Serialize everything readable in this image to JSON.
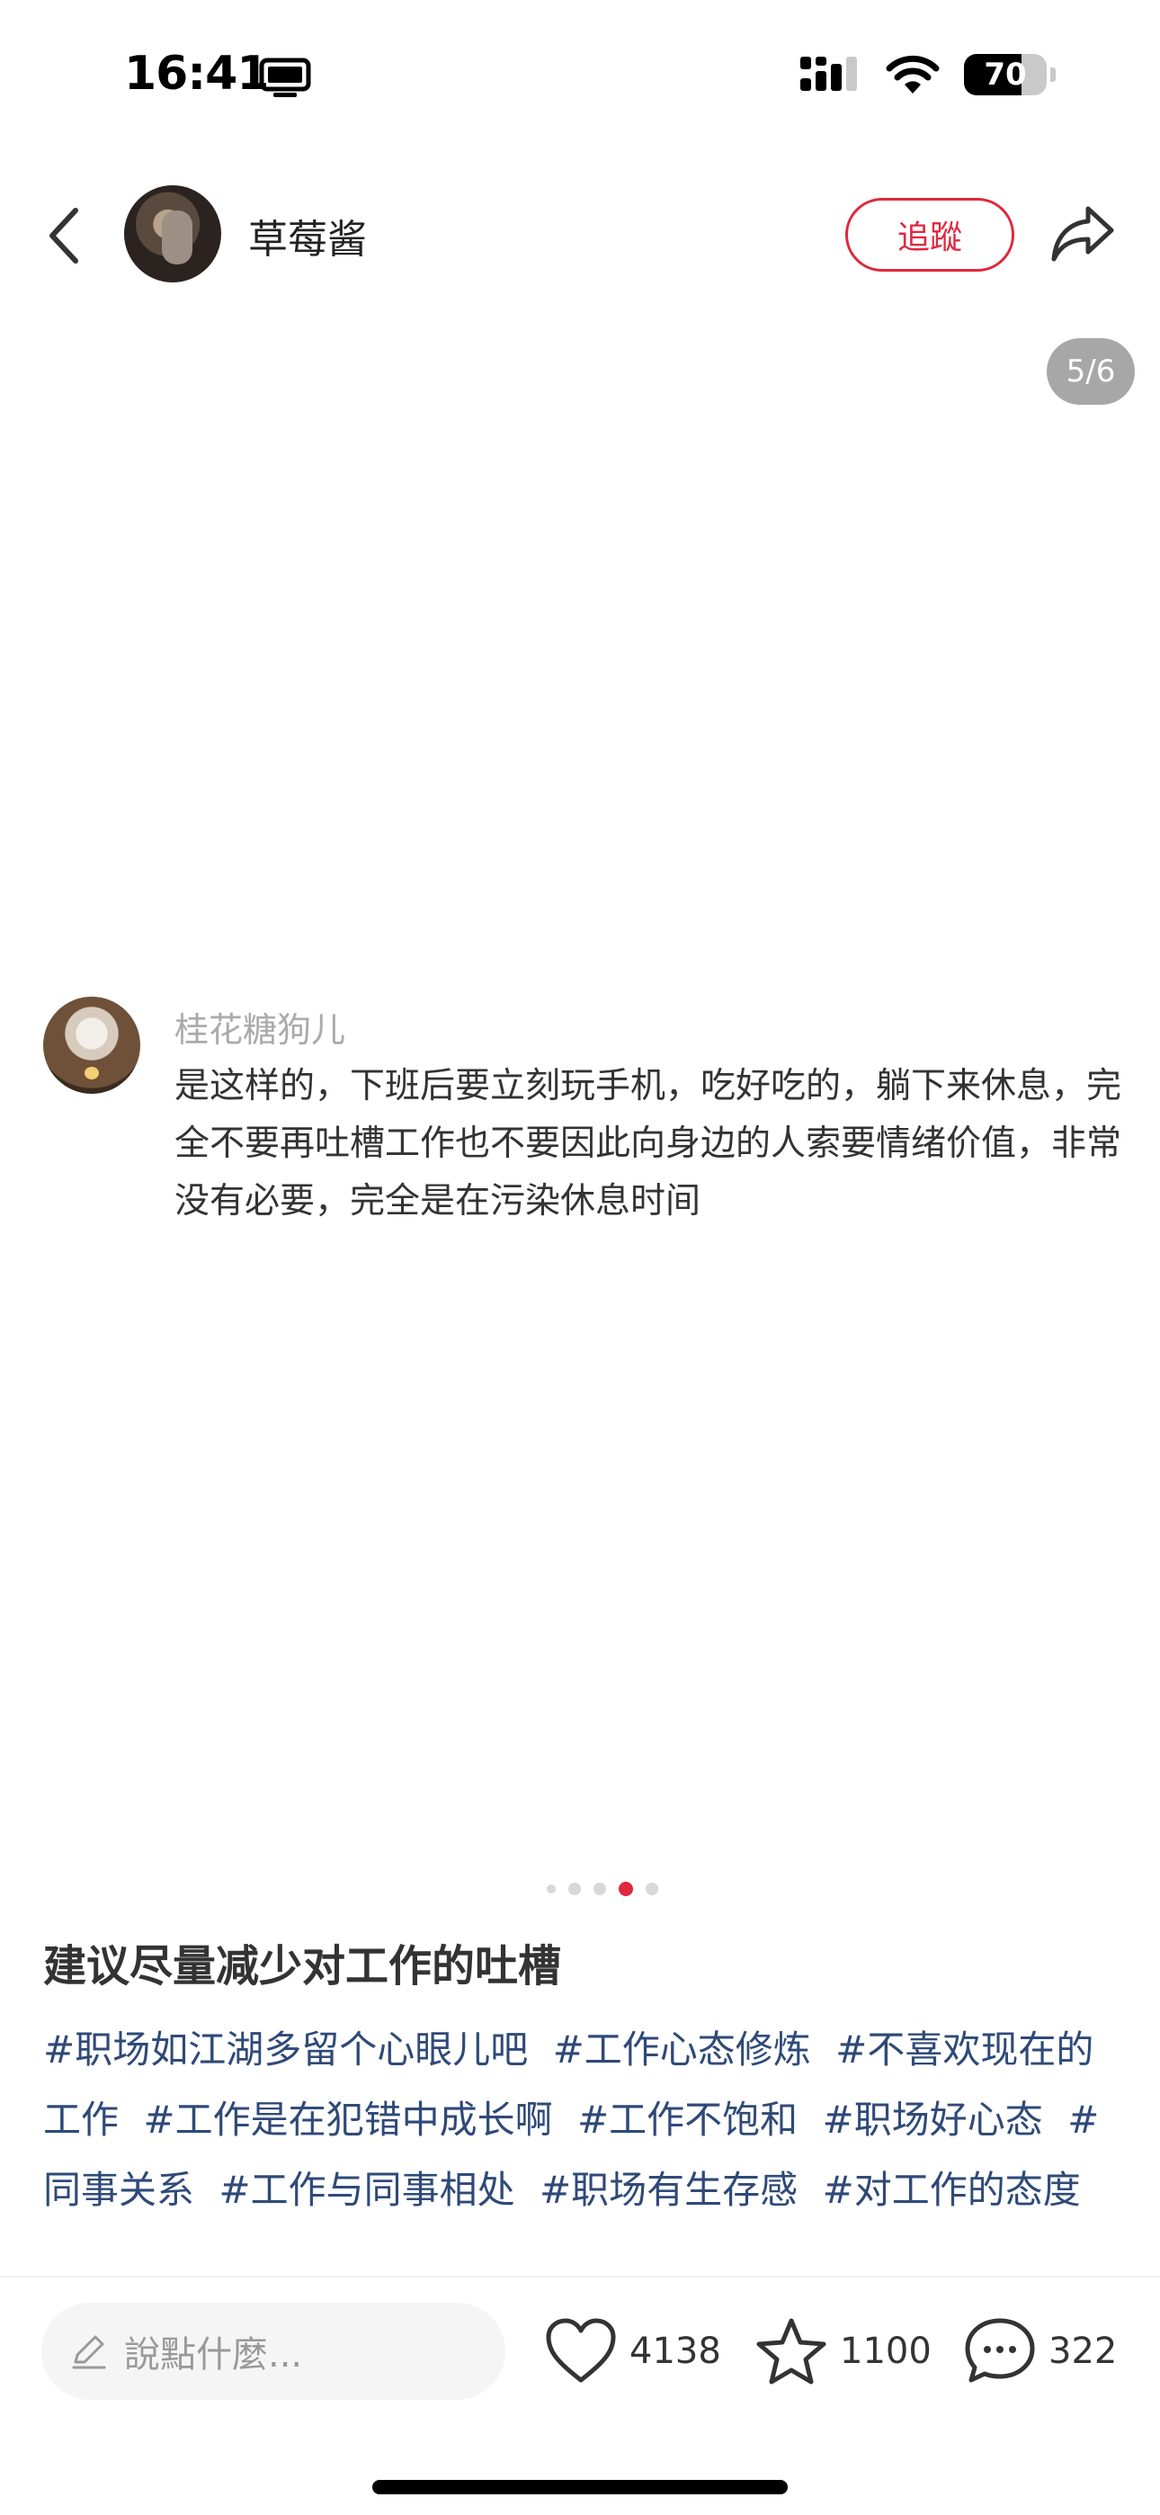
{
  "status_bar": {
    "time": "16:41",
    "battery": "70",
    "battery_level": 0.7
  },
  "header": {
    "author_name": "草莓酱",
    "follow_label": "追蹤"
  },
  "page_counter": "5/6",
  "carousel": {
    "total": 5,
    "active_index": 3
  },
  "comment_card": {
    "username": "桂花糖狗儿",
    "text": "是这样的，下班后要立刻玩手机，吃好吃的，躺下来休息，完全不要再吐槽工作也不要因此向身边的人索要情绪价值，非常没有必要，完全是在污染休息时间"
  },
  "post": {
    "title": "建议尽量减少对工作的吐槽",
    "hashtags": [
      "#职场如江湖多留个心眼儿吧",
      "#工作心态修炼",
      "#不喜欢现在的工作",
      "#工作是在犯错中成长啊",
      "#工作不饱和",
      "#职场好心态",
      "#同事关系",
      "#工作与同事相处",
      "#职场有生存感",
      "#对工作的态度"
    ]
  },
  "bottom_bar": {
    "comment_placeholder": "說點什麼...",
    "likes": "4138",
    "favorites": "1100",
    "comments": "322"
  },
  "colors": {
    "accent": "#e0283e",
    "hashtag": "#2f4a78",
    "muted": "#aaaaaa"
  },
  "icons": [
    "screen-mirroring-icon",
    "signal-icon",
    "wifi-icon",
    "battery-icon",
    "back-icon",
    "share-icon",
    "pencil-icon",
    "heart-icon",
    "star-icon",
    "comment-bubble-icon"
  ]
}
